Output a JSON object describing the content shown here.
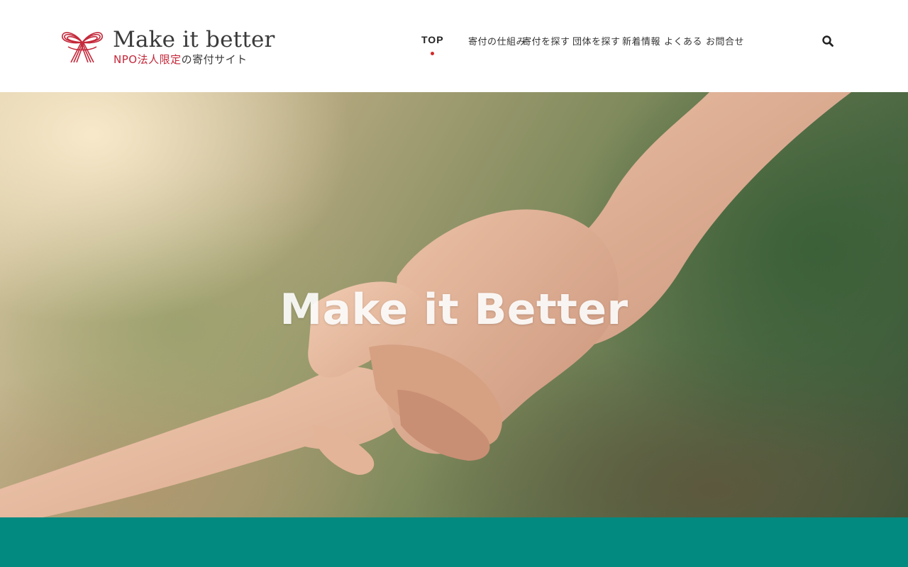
{
  "brand": {
    "title": "Make it better",
    "subtitle_red": "NPO法人限定",
    "subtitle_dark": "の寄付サイト",
    "accent_color": "#c4283a"
  },
  "nav": {
    "items": [
      {
        "label": "TOP",
        "active": true
      },
      {
        "label": "寄付の仕組み",
        "active": false
      },
      {
        "label": "寄付を探す",
        "active": false
      },
      {
        "label": "団体を探す",
        "active": false
      },
      {
        "label": "新着情報",
        "active": false
      },
      {
        "label": "よくある",
        "active": false
      },
      {
        "label": "お問合せ",
        "active": false
      }
    ],
    "active_indicator_color": "#d22a2a",
    "search_icon": "search-icon"
  },
  "hero": {
    "title": "Make it Better",
    "image": "two-hands-holding-wrists"
  },
  "band": {
    "color": "#028980"
  }
}
